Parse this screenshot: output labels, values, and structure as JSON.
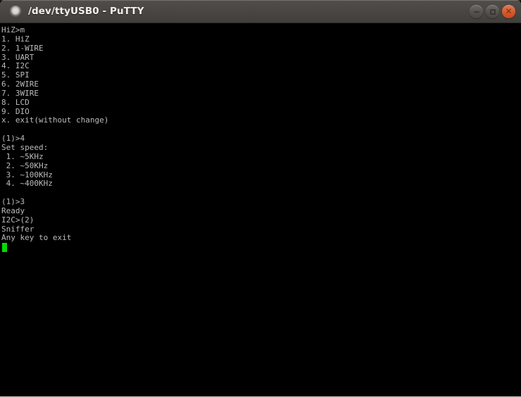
{
  "window": {
    "title": "/dev/ttyUSB0 - PuTTY",
    "icon": "terminal-circle-icon",
    "controls": {
      "minimize_label": "–",
      "maximize_label": "□",
      "close_label": "✕"
    },
    "colors": {
      "titlebar": "#4a4744",
      "title_text": "#f2efe9",
      "close_button": "#d6592c",
      "terminal_background": "#000000",
      "terminal_text": "#bbbbbb",
      "cursor": "#00dd00"
    }
  },
  "terminal": {
    "lines": [
      "HiZ>m",
      "1. HiZ",
      "2. 1-WIRE",
      "3. UART",
      "4. I2C",
      "5. SPI",
      "6. 2WIRE",
      "7. 3WIRE",
      "8. LCD",
      "9. DIO",
      "x. exit(without change)",
      "",
      "(1)>4",
      "Set speed:",
      " 1. ~5KHz",
      " 2. ~50KHz",
      " 3. ~100KHz",
      " 4. ~400KHz",
      "",
      "(1)>3",
      "Ready",
      "I2C>(2)",
      "Sniffer",
      "Any key to exit"
    ],
    "cursor_visible": true
  }
}
